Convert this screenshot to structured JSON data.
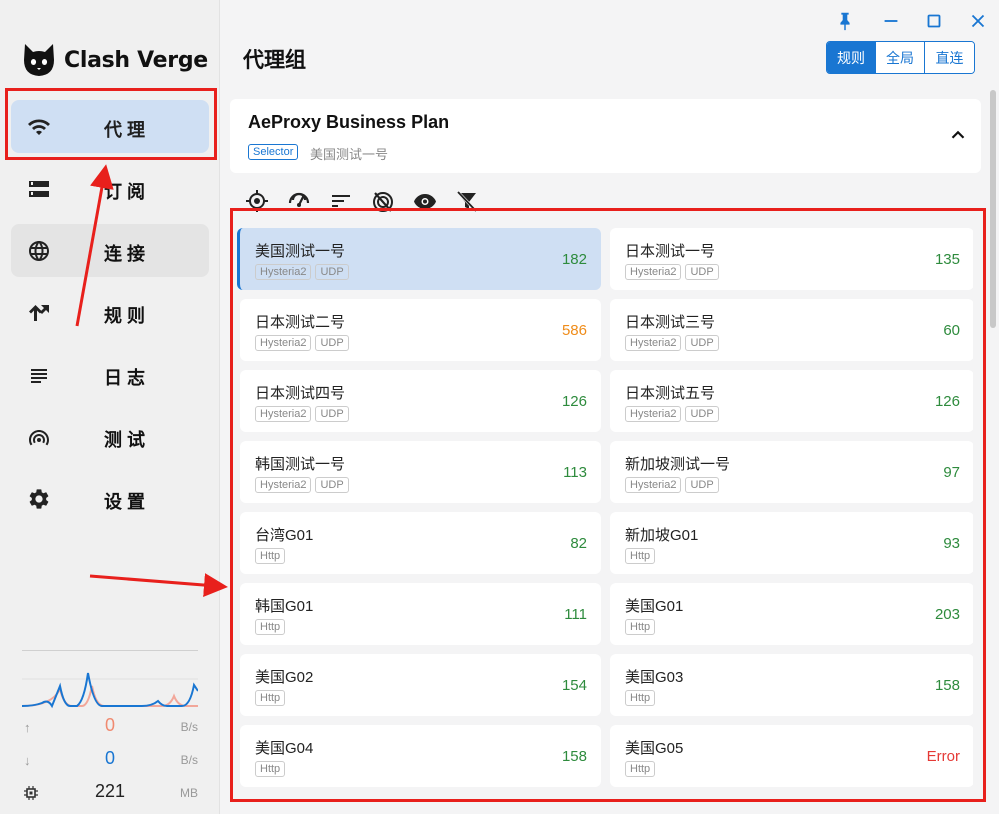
{
  "app": {
    "logo_text": "Clash Verge"
  },
  "sidebar": {
    "items": [
      {
        "label": "代理",
        "icon": "wifi-icon"
      },
      {
        "label": "订阅",
        "icon": "storage-icon"
      },
      {
        "label": "连接",
        "icon": "globe-icon"
      },
      {
        "label": "规则",
        "icon": "fork-icon"
      },
      {
        "label": "日志",
        "icon": "list-icon"
      },
      {
        "label": "测试",
        "icon": "radar-icon"
      },
      {
        "label": "设置",
        "icon": "gear-icon"
      }
    ],
    "active_index": 0
  },
  "traffic": {
    "up_value": "0",
    "up_unit": "B/s",
    "down_value": "0",
    "down_unit": "B/s",
    "memory_value": "221",
    "memory_unit": "MB"
  },
  "header": {
    "title": "代理组",
    "modes": [
      "规则",
      "全局",
      "直连"
    ],
    "active_mode": 0
  },
  "group": {
    "name": "AeProxy Business Plan",
    "type": "Selector",
    "current": "美国测试一号"
  },
  "proxies": [
    {
      "name": "美国测试一号",
      "tags": [
        "Hysteria2",
        "UDP"
      ],
      "delay": "182",
      "delay_color": "#2e8b3d",
      "selected": true
    },
    {
      "name": "日本测试一号",
      "tags": [
        "Hysteria2",
        "UDP"
      ],
      "delay": "135",
      "delay_color": "#2e8b3d",
      "selected": false
    },
    {
      "name": "日本测试二号",
      "tags": [
        "Hysteria2",
        "UDP"
      ],
      "delay": "586",
      "delay_color": "#ef8c1a",
      "selected": false
    },
    {
      "name": "日本测试三号",
      "tags": [
        "Hysteria2",
        "UDP"
      ],
      "delay": "60",
      "delay_color": "#2e8b3d",
      "selected": false
    },
    {
      "name": "日本测试四号",
      "tags": [
        "Hysteria2",
        "UDP"
      ],
      "delay": "126",
      "delay_color": "#2e8b3d",
      "selected": false
    },
    {
      "name": "日本测试五号",
      "tags": [
        "Hysteria2",
        "UDP"
      ],
      "delay": "126",
      "delay_color": "#2e8b3d",
      "selected": false
    },
    {
      "name": "韩国测试一号",
      "tags": [
        "Hysteria2",
        "UDP"
      ],
      "delay": "113",
      "delay_color": "#2e8b3d",
      "selected": false
    },
    {
      "name": "新加坡测试一号",
      "tags": [
        "Hysteria2",
        "UDP"
      ],
      "delay": "97",
      "delay_color": "#2e8b3d",
      "selected": false
    },
    {
      "name": "台湾G01",
      "tags": [
        "Http"
      ],
      "delay": "82",
      "delay_color": "#2e8b3d",
      "selected": false
    },
    {
      "name": "新加坡G01",
      "tags": [
        "Http"
      ],
      "delay": "93",
      "delay_color": "#2e8b3d",
      "selected": false
    },
    {
      "name": "韩国G01",
      "tags": [
        "Http"
      ],
      "delay": "111",
      "delay_color": "#2e8b3d",
      "selected": false
    },
    {
      "name": "美国G01",
      "tags": [
        "Http"
      ],
      "delay": "203",
      "delay_color": "#2e8b3d",
      "selected": false
    },
    {
      "name": "美国G02",
      "tags": [
        "Http"
      ],
      "delay": "154",
      "delay_color": "#2e8b3d",
      "selected": false
    },
    {
      "name": "美国G03",
      "tags": [
        "Http"
      ],
      "delay": "158",
      "delay_color": "#2e8b3d",
      "selected": false
    },
    {
      "name": "美国G04",
      "tags": [
        "Http"
      ],
      "delay": "158",
      "delay_color": "#2e8b3d",
      "selected": false
    },
    {
      "name": "美国G05",
      "tags": [
        "Http"
      ],
      "delay": "Error",
      "delay_color": "#e53935",
      "selected": false
    }
  ],
  "colors": {
    "accent": "#1976d2",
    "annotation": "#e8201c"
  }
}
